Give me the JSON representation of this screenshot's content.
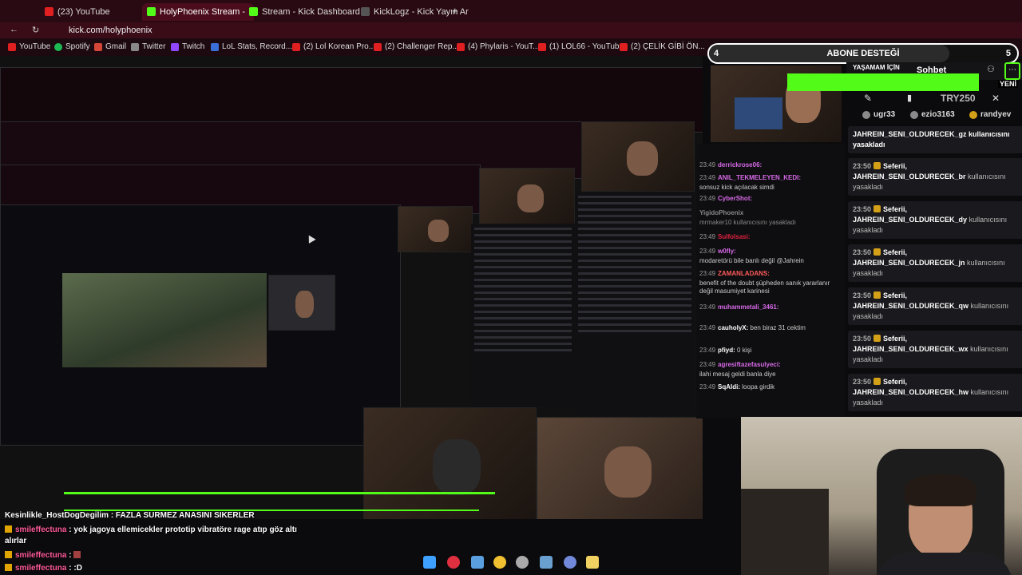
{
  "browser": {
    "tabs": [
      {
        "label": "(23) YouTube",
        "color": "#e02020",
        "active": false
      },
      {
        "label": "HolyPhoenix Stream -",
        "color": "#53fc18",
        "active": true
      },
      {
        "label": "Stream - Kick Dashboard",
        "color": "#53fc18",
        "active": false
      },
      {
        "label": "KickLogz - Kick Yayın Ar",
        "color": "#333333",
        "active": false
      }
    ],
    "new_tab": "+",
    "url": "kick.com/holyphoenix",
    "bookmarks": [
      {
        "label": "YouTube",
        "color": "#e02020"
      },
      {
        "label": "Spotify",
        "color": "#1db954"
      },
      {
        "label": "Gmail",
        "color": "#d44638"
      },
      {
        "label": "Twitter",
        "color": "#888888"
      },
      {
        "label": "Twitch",
        "color": "#9146ff"
      },
      {
        "label": "LoL Stats, Record...",
        "color": "#3b6fd8"
      },
      {
        "label": "(2) Lol Korean Pro...",
        "color": "#e02020"
      },
      {
        "label": "(2) Challenger Rep...",
        "color": "#e02020"
      },
      {
        "label": "(4) Phylaris - YouT...",
        "color": "#e02020"
      },
      {
        "label": "(1) LOL66 - YouTube",
        "color": "#e02020"
      },
      {
        "label": "(2) ÇELİK GİBİ ÖN...",
        "color": "#e02020"
      }
    ]
  },
  "sub_goal": {
    "start": "4",
    "label": "ABONE DESTEĞİ",
    "end": "5",
    "progress": 0.78
  },
  "chat": {
    "title": "Sohbet",
    "menu_icon": "ellipsis-icon",
    "new_label": "YENİ",
    "banner_text": "YAŞAMAM İÇİN",
    "try_label": "TRY250",
    "top_chatters": [
      "ugr33",
      "ezio3163",
      "randyev"
    ],
    "messages": [
      {
        "time": "",
        "user": "",
        "text": "JAHREIN_SENI_OLDURECEK_gz kullanıcısını yasakladı"
      },
      {
        "time": "23:50",
        "user": "Seferii,",
        "bold": "JAHREIN_SENI_OLDURECEK_br",
        "text": "kullanıcısını yasakladı"
      },
      {
        "time": "23:50",
        "user": "Seferii,",
        "bold": "JAHREIN_SENI_OLDURECEK_dy",
        "text": "kullanıcısını yasakladı"
      },
      {
        "time": "23:50",
        "user": "Seferii,",
        "bold": "JAHREIN_SENI_OLDURECEK_jn",
        "text": "kullanıcısını yasakladı"
      },
      {
        "time": "23:50",
        "user": "Seferii,",
        "bold": "JAHREIN_SENI_OLDURECEK_qw",
        "text": "kullanıcısını yasakladı"
      },
      {
        "time": "23:50",
        "user": "Seferii,",
        "bold": "JAHREIN_SENI_OLDURECEK_wx",
        "text": "kullanıcısını yasakladı"
      },
      {
        "time": "23:50",
        "user": "Seferii,",
        "bold": "JAHREIN_SENI_OLDURECEK_hw",
        "text": "kullanıcısını yasakladı"
      }
    ]
  },
  "inner_chat": [
    {
      "time": "23:49",
      "user": "derrickrose06:",
      "text": ""
    },
    {
      "time": "23:49",
      "user": "ANIL_TEKMELEYEN_KEDI:",
      "text": "sonsuz kick açılacak simdi"
    },
    {
      "time": "23:49",
      "user": "CyberShot:",
      "text": ""
    },
    {
      "time": "23:49",
      "user": "YigidoPhoenix",
      "text": "mrmaker10 kullanıcısını yasakladı"
    },
    {
      "time": "23:49",
      "user": "Sulfolsasi:",
      "text": ""
    },
    {
      "time": "23:49",
      "user": "w0fly:",
      "text": "modaretörü bile banlı değil @Jahrein"
    },
    {
      "time": "23:49",
      "user": "ZAMANLADANS:",
      "text": "benefit of the doubt şüpheden sanık yararlanır değil masumiyet karinesi"
    },
    {
      "time": "23:49",
      "user": "muhammetali_3461:",
      "text": ""
    },
    {
      "time": "23:49",
      "user": "cauholyX:",
      "text": "ben biraz 31 cektim"
    },
    {
      "time": "23:49",
      "user": "pfiyd:",
      "text": "0 kişi"
    },
    {
      "time": "23:49",
      "user": "agresiftazefasulyeci:",
      "text": "ilahi mesaj geldi banla diye"
    },
    {
      "time": "23:49",
      "user": "SqAldi:",
      "text": "loopa girdik"
    }
  ],
  "overlay_chat": [
    {
      "user": "Kesinlikle_HostDogDegilim",
      "text": ": FAZLA SURMEZ ANASINI SIKERLER",
      "pink": false
    },
    {
      "user": "smileffectuna",
      "text": ": yok jagoya ellemicekler prototip vibratöre rage atıp göz altı",
      "pink": true
    },
    {
      "user": "",
      "text": "alırlar",
      "pink": false
    },
    {
      "user": "smileffectuna",
      "text": ":",
      "pink": true
    },
    {
      "user": "smileffectuna",
      "text": ": :D",
      "pink": true
    }
  ],
  "taskbar": {
    "icons": [
      "windows-icon",
      "kick-icon",
      "files-icon",
      "chrome-icon",
      "app-icon",
      "settings-icon",
      "discord-icon",
      "explorer-icon"
    ],
    "colors": [
      "#3ea0ff",
      "#e03040",
      "#5aa0e0",
      "#f0c030",
      "#aaaaaa",
      "#6aa0d0",
      "#7289da",
      "#f0d060"
    ]
  }
}
